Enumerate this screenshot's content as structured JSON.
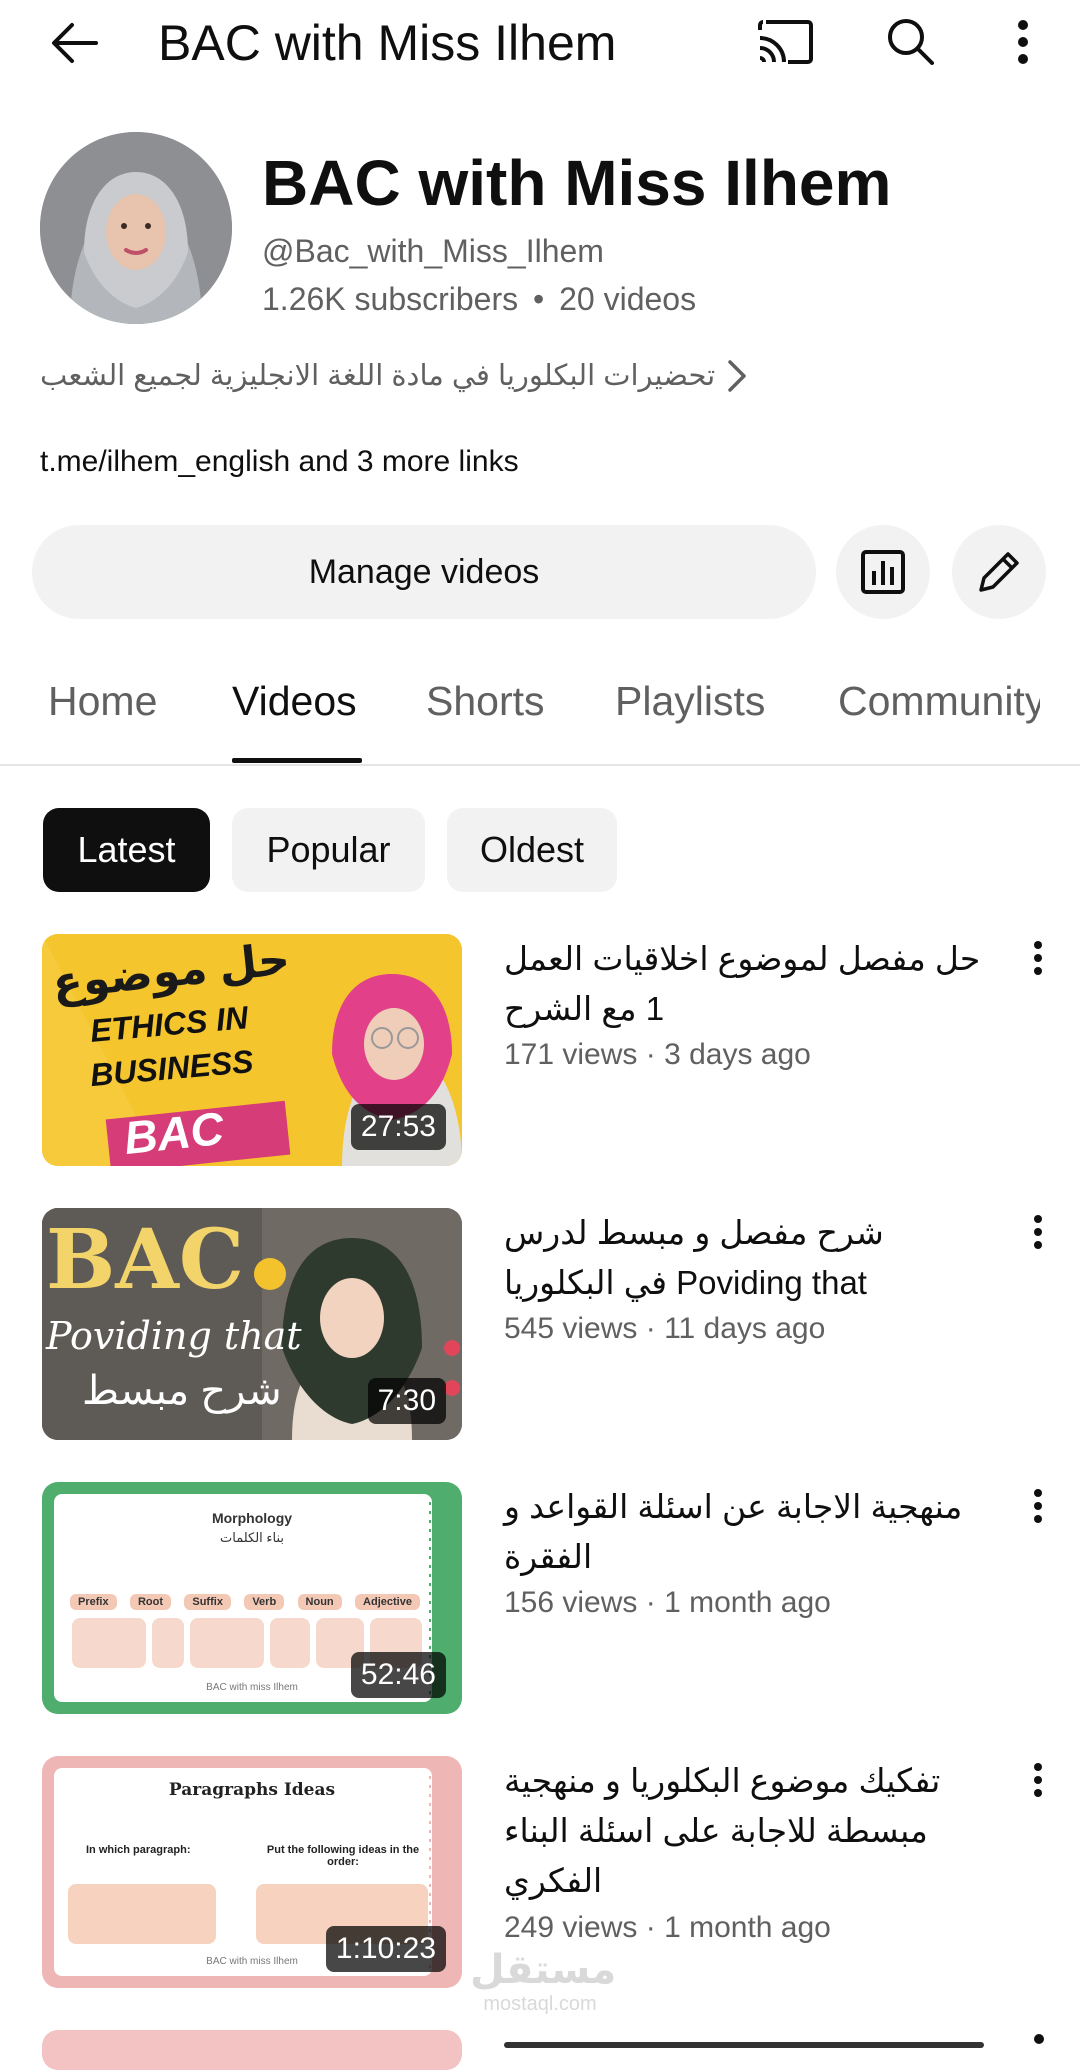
{
  "topbar": {
    "title": "BAC with Miss Ilhem"
  },
  "channel": {
    "name": "BAC with Miss Ilhem",
    "handle": "@Bac_with_Miss_Ilhem",
    "subscribers": "1.26K subscribers",
    "separator": "•",
    "videos_count": "20 videos",
    "description": "تحضيرات البكلوريا في مادة اللغة الانجليزية لجميع الشعب",
    "links": "t.me/ilhem_english and 3 more links"
  },
  "actions": {
    "manage_label": "Manage videos"
  },
  "tabs": [
    {
      "label": "Home"
    },
    {
      "label": "Videos"
    },
    {
      "label": "Shorts"
    },
    {
      "label": "Playlists"
    },
    {
      "label": "Community"
    }
  ],
  "chips": [
    {
      "label": "Latest"
    },
    {
      "label": "Popular"
    },
    {
      "label": "Oldest"
    }
  ],
  "videos": [
    {
      "title": "حل مفصل لموضوع اخلاقيات العمل 1 مع الشرح",
      "meta": "171 views · 3 days ago",
      "duration": "27:53",
      "thumb_text": {
        "top": "حل موضوع",
        "l1": "ETHICS IN",
        "l2": "BUSINESS",
        "tag": "BAC"
      }
    },
    {
      "title": "شرح مفصل و مبسط لدرس Poviding that في البكلوريا",
      "meta": "545 views · 11 days ago",
      "duration": "7:30",
      "thumb_text": {
        "top": "BAC",
        "mid": "Poviding that",
        "bottom": "شرح مبسط"
      }
    },
    {
      "title": "منهجية الاجابة عن اسئلة القواعد و الفقرة",
      "meta": "156 views · 1 month ago",
      "duration": "52:46",
      "thumb_text": {
        "heading": "Morphology",
        "sub": "بناء الكلمات",
        "cols": [
          "Prefix",
          "Root",
          "Suffix",
          "Verb",
          "Noun",
          "Adjective"
        ],
        "footer": "BAC with miss Ilhem"
      }
    },
    {
      "title": "تفكيك موضوع البكلوريا و منهجية مبسطة للاجابة على اسئلة البناء الفكري",
      "meta": "249 views · 1 month ago",
      "duration": "1:10:23",
      "thumb_text": {
        "heading": "Paragraphs Ideas",
        "left": "In which paragraph:",
        "right": "Put the following ideas in the order:",
        "footer": "BAC with miss Ilhem"
      }
    }
  ],
  "watermark": {
    "arabic": "مستقل",
    "latin": "mostaql.com"
  },
  "colors": {
    "text": "#0f0f0f",
    "secondary": "#606060",
    "chip_bg": "#f2f2f2",
    "chip_selected": "#0f0f0f"
  }
}
